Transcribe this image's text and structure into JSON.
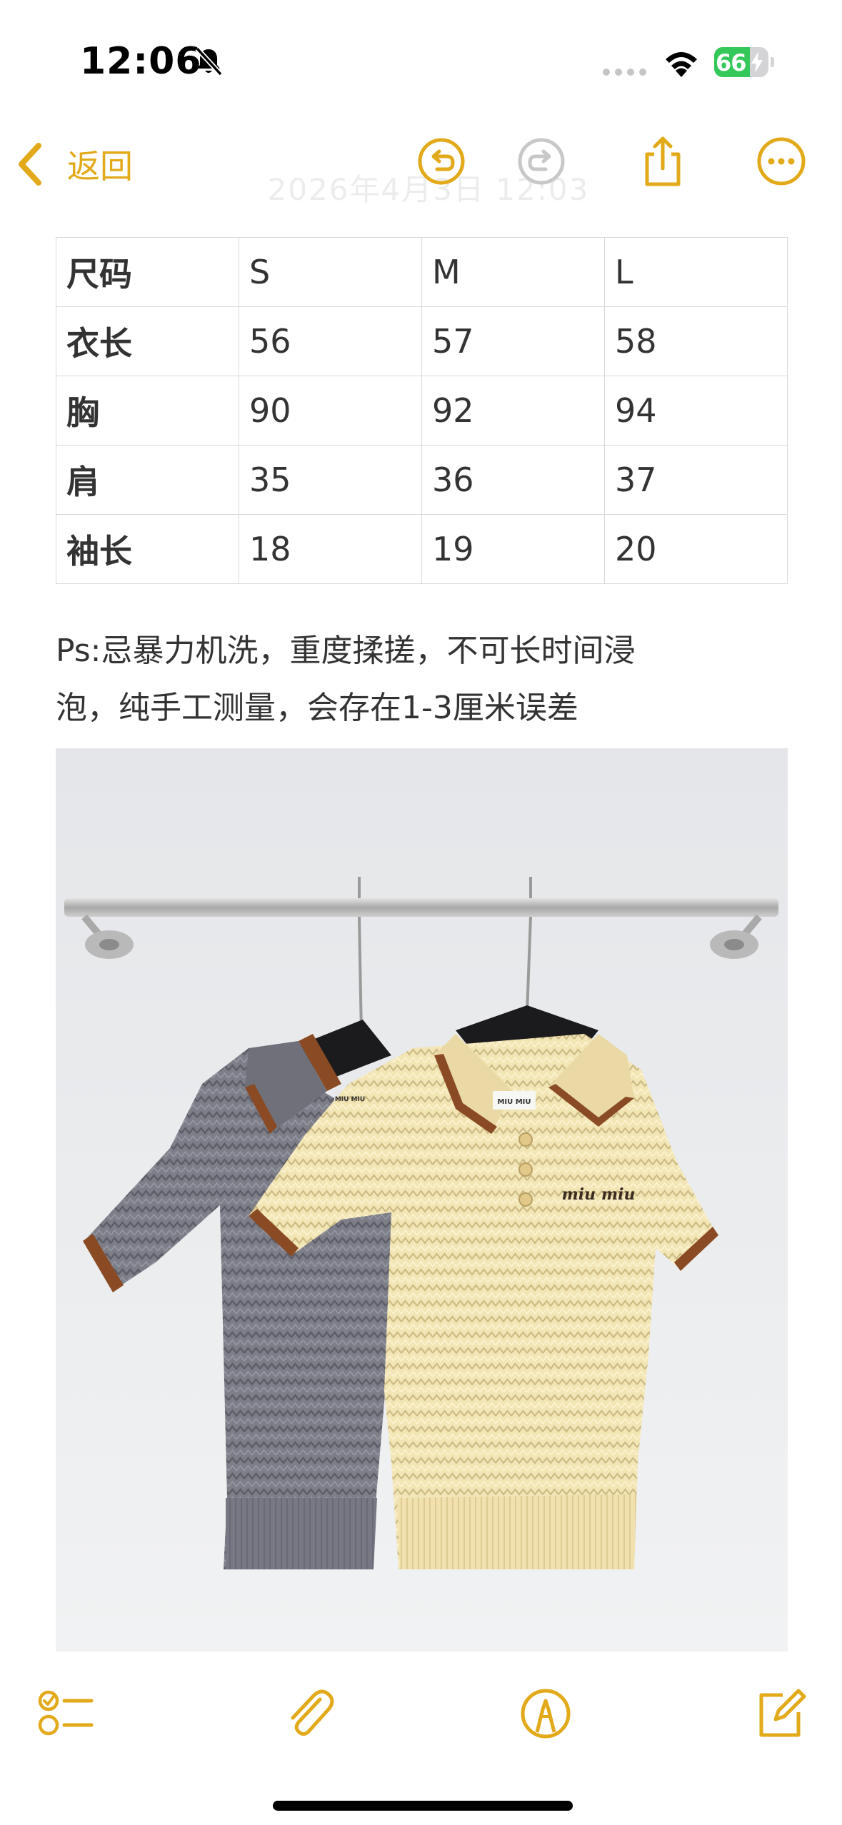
{
  "status_bar": {
    "time": "12:06",
    "battery_level": 66,
    "battery_text": "66",
    "charging": true,
    "silent_mode": true
  },
  "nav": {
    "back_label": "返回",
    "faded_date": "2026年4月3日 12:03",
    "icons": [
      "chevron-left-icon",
      "undo-icon",
      "redo-icon",
      "share-icon",
      "more-icon"
    ],
    "accent_color": "#e2aa1a"
  },
  "size_table": {
    "columns": [
      "尺码",
      "S",
      "M",
      "L"
    ],
    "rows": [
      [
        "衣长",
        "56",
        "57",
        "58"
      ],
      [
        "胸",
        "90",
        "92",
        "94"
      ],
      [
        "肩",
        "35",
        "36",
        "37"
      ],
      [
        "袖长",
        "18",
        "19",
        "20"
      ]
    ]
  },
  "note": {
    "line1": "Ps:忌暴力机洗，重度揉搓，不可长时间浸",
    "line2": "泡，纯手工测量，会存在1-3厘米误差"
  },
  "photo": {
    "label_left": "MIU MIU",
    "label_right": "MIU MIU",
    "logo_text": "miu miu"
  },
  "toolbar": {
    "icons": [
      "checklist-icon",
      "paperclip-icon",
      "markup-icon",
      "compose-icon"
    ]
  }
}
